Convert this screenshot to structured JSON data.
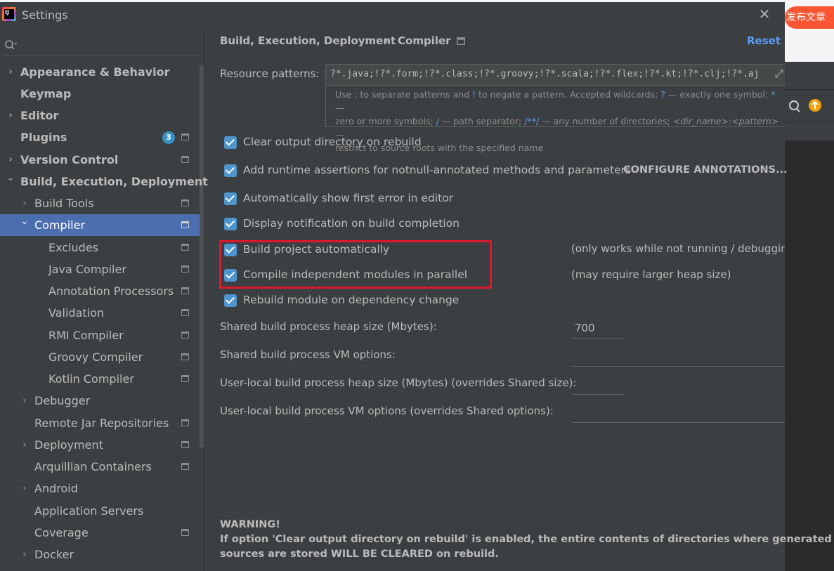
{
  "window": {
    "title": "Settings",
    "close": "✕"
  },
  "background_app": {
    "publish_button": "发布文章"
  },
  "sidebar": {
    "search_placeholder": "",
    "items": [
      {
        "label": "Appearance & Behavior",
        "expandable": true,
        "bold": true
      },
      {
        "label": "Keymap",
        "bold": true
      },
      {
        "label": "Editor",
        "expandable": true,
        "bold": true
      },
      {
        "label": "Plugins",
        "bold": true,
        "badge": "3"
      },
      {
        "label": "Version Control",
        "expandable": true,
        "bold": true
      },
      {
        "label": "Build, Execution, Deployment",
        "expanded": true,
        "bold": true
      },
      {
        "label": "Build Tools",
        "expandable": true
      },
      {
        "label": "Compiler",
        "expanded": true,
        "selected": true
      },
      {
        "label": "Excludes"
      },
      {
        "label": "Java Compiler"
      },
      {
        "label": "Annotation Processors"
      },
      {
        "label": "Validation"
      },
      {
        "label": "RMI Compiler"
      },
      {
        "label": "Groovy Compiler"
      },
      {
        "label": "Kotlin Compiler"
      },
      {
        "label": "Debugger",
        "expandable": true
      },
      {
        "label": "Remote Jar Repositories"
      },
      {
        "label": "Deployment",
        "expandable": true
      },
      {
        "label": "Arquillian Containers"
      },
      {
        "label": "Android",
        "expandable": true
      },
      {
        "label": "Application Servers"
      },
      {
        "label": "Coverage"
      },
      {
        "label": "Docker",
        "expandable": true
      }
    ]
  },
  "breadcrumb": {
    "parent": "Build, Execution, Deployment",
    "separator": "›",
    "current": "Compiler"
  },
  "reset_label": "Reset",
  "resource_patterns": {
    "label": "Resource patterns:",
    "value": "?*.java;!?*.form;!?*.class;!?*.groovy;!?*.scala;!?*.flex;!?*.kt;!?*.clj;!?*.aj",
    "hint": {
      "p1": "Use ; to separate patterns and ",
      "bang": "!",
      "p2": " to negate a pattern. Accepted wildcards: ",
      "q": "?",
      "p3": " — exactly one symbol; ",
      "star": "*",
      "p4": " —",
      "p5": "zero or more symbols; ",
      "slash": "/",
      "p6": " — path separator; ",
      "dstar": "/**/",
      "p7": " — any number of directories; ",
      "dir": "<dir_name>:<pattern>",
      "p8": " —",
      "p9": "restrict to source roots with the specified name"
    }
  },
  "options": {
    "clear_output": {
      "label": "Clear output directory on rebuild",
      "checked": true
    },
    "runtime_assertions": {
      "label": "Add runtime assertions for notnull-annotated methods and parameters",
      "checked": true
    },
    "configure_annotations": "CONFIGURE ANNOTATIONS...",
    "show_first_error": {
      "label": "Automatically show first error in editor",
      "checked": true
    },
    "notify_completion": {
      "label": "Display notification on build completion",
      "checked": true
    },
    "build_auto": {
      "label": "Build project automatically",
      "checked": true,
      "note": "(only works while not running / debugging"
    },
    "parallel": {
      "label": "Compile independent modules in parallel",
      "checked": true,
      "note": "(may require larger heap size)"
    },
    "rebuild_dep": {
      "label": "Rebuild module on dependency change",
      "checked": true
    }
  },
  "fields": {
    "shared_heap": {
      "label": "Shared build process heap size (Mbytes):",
      "value": "700"
    },
    "shared_vm": {
      "label": "Shared build process VM options:",
      "value": ""
    },
    "local_heap": {
      "label": "User-local build process heap size (Mbytes) (overrides Shared size):",
      "value": ""
    },
    "local_vm": {
      "label": "User-local build process VM options (overrides Shared options):",
      "value": ""
    }
  },
  "warning": {
    "title": "WARNING!",
    "line1": "If option 'Clear output directory on rebuild' is enabled, the entire contents of directories where generated",
    "line2": "sources are stored WILL BE CLEARED on rebuild."
  },
  "colors": {
    "selection": "#4b6eaf",
    "checkbox": "#4e94ce",
    "link": "#589df6",
    "annotation_box": "#e0182b",
    "background": "#3c3f41"
  }
}
